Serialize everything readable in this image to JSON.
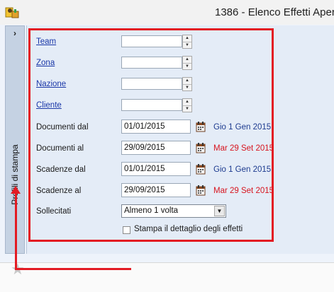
{
  "window": {
    "title": "1386 - Elenco Effetti Aper"
  },
  "side_panel": {
    "label": "Profili di stampa",
    "chevron": "›"
  },
  "form": {
    "fields": [
      {
        "label": "Team",
        "value": "",
        "linked": true
      },
      {
        "label": "Zona",
        "value": "",
        "linked": true
      },
      {
        "label": "Nazione",
        "value": "",
        "linked": true
      },
      {
        "label": "Cliente",
        "value": "",
        "linked": true
      }
    ],
    "dates": [
      {
        "label": "Documenti dal",
        "value": "01/01/2015",
        "display": "Gio 1 Gen 2015",
        "color": "#1c3a8f"
      },
      {
        "label": "Documenti al",
        "value": "29/09/2015",
        "display": "Mar 29 Set 2015",
        "color": "#d7141f"
      },
      {
        "label": "Scadenze dal",
        "value": "01/01/2015",
        "display": "Gio 1 Gen 2015",
        "color": "#1c3a8f"
      },
      {
        "label": "Scadenze al",
        "value": "29/09/2015",
        "display": "Mar 29 Set 2015",
        "color": "#d7141f"
      }
    ],
    "sollecitati": {
      "label": "Sollecitati",
      "value": "Almeno 1 volta"
    },
    "print_detail": {
      "label": "Stampa il dettaglio degli effetti",
      "checked": false
    }
  },
  "annotation": {
    "color": "#e31b23"
  },
  "icons": {
    "app": "app-icon",
    "calendar": "calendar-icon",
    "favorite": "star-icon"
  }
}
